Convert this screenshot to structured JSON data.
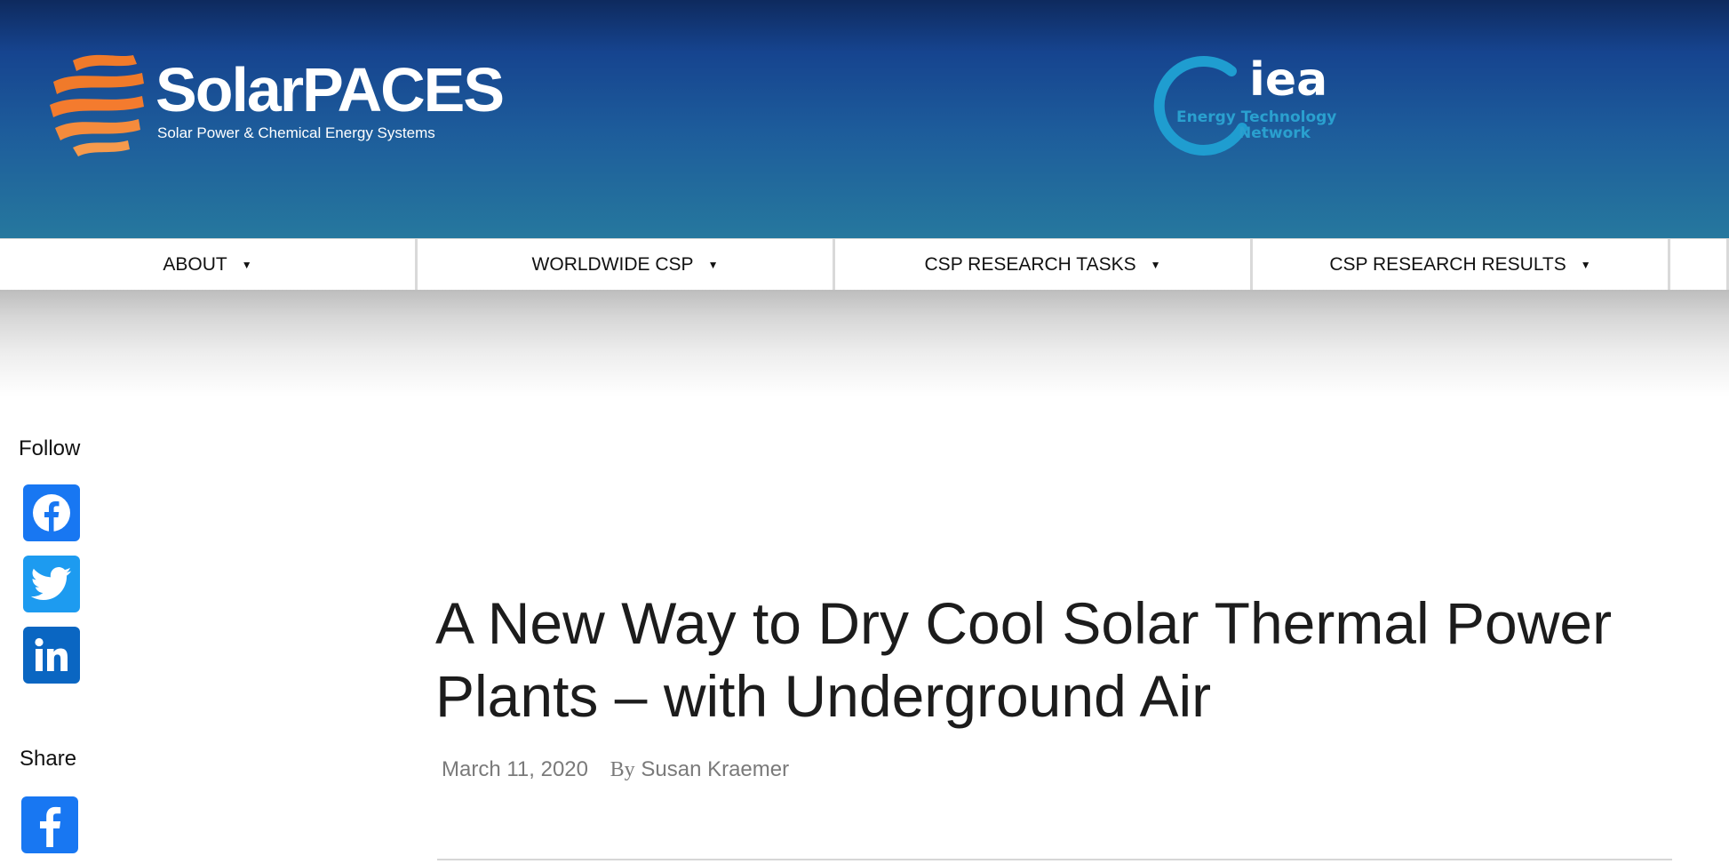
{
  "header": {
    "logo_name": "SolarPACES",
    "logo_tagline": "Solar Power & Chemical Energy Systems",
    "partner_logo_name": "iea",
    "partner_logo_line1": "Energy Technology",
    "partner_logo_line2": "Network"
  },
  "nav": {
    "items": [
      {
        "label": "ABOUT"
      },
      {
        "label": "WORLDWIDE CSP"
      },
      {
        "label": "CSP RESEARCH TASKS"
      },
      {
        "label": "CSP RESEARCH RESULTS"
      }
    ],
    "dropdown_glyph": "▼"
  },
  "sidebar": {
    "follow_label": "Follow",
    "follow_icons": [
      "facebook-icon",
      "twitter-icon",
      "linkedin-icon"
    ],
    "share_label": "Share",
    "share_icons": [
      "facebook-icon"
    ]
  },
  "article": {
    "title": "A New Way to Dry Cool Solar Thermal Power Plants – with Underground Air",
    "date": "March 11, 2020",
    "by_label": "By",
    "author": "Susan Kraemer"
  },
  "colors": {
    "header_top": "#0e2a5e",
    "header_bottom": "#26789e",
    "facebook": "#1877f2",
    "twitter": "#1d9bf0",
    "linkedin": "#0a66c2",
    "logo_orange": "#f07a2a"
  }
}
